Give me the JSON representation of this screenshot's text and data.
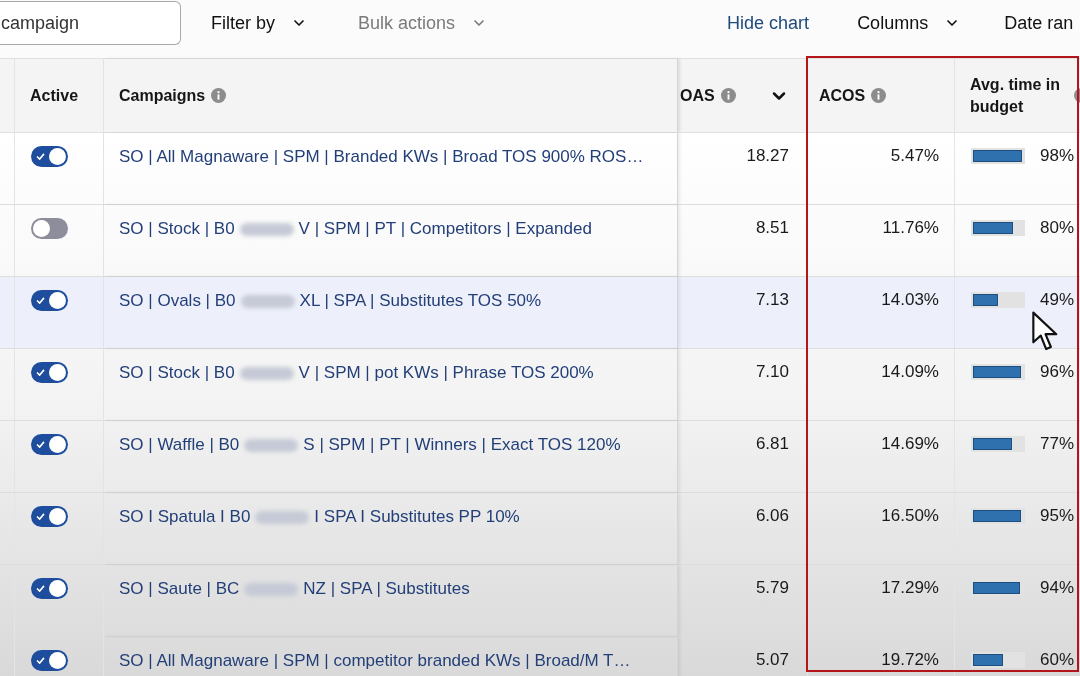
{
  "toolbar": {
    "search": {
      "placeholder": "campaign"
    },
    "items": [
      {
        "label": "Filter by",
        "kind": "dropdown",
        "disabled": false
      },
      {
        "label": "Bulk actions",
        "kind": "dropdown",
        "disabled": true
      },
      {
        "label": "Hide chart",
        "kind": "link",
        "disabled": false
      },
      {
        "label": "Columns",
        "kind": "dropdown",
        "disabled": false
      },
      {
        "label": "Date ran",
        "kind": "button",
        "disabled": false
      }
    ]
  },
  "table": {
    "columns": [
      {
        "label": "Active",
        "kind": "plain"
      },
      {
        "label": "Campaigns",
        "kind": "info"
      },
      {
        "label": "OAS",
        "kind": "info_sort"
      },
      {
        "label": "ACOS",
        "kind": "info"
      },
      {
        "label": "Avg. time in budget",
        "kind": "info"
      }
    ],
    "rows": [
      {
        "active": true,
        "highlighted": false,
        "campaign": [
          "SO | All Magnaware | SPM | Branded KWs | Broad TOS 900% ROS…"
        ],
        "roas": "18.27",
        "acos": "5.47%",
        "budget": {
          "level": 0.98,
          "reading": "98%"
        }
      },
      {
        "active": false,
        "highlighted": false,
        "campaign": [
          "SO | Stock | B0",
          "V | SPM | PT | Competitors | Expanded"
        ],
        "roas": "8.51",
        "acos": "11.76%",
        "budget": {
          "level": 0.8,
          "reading": "80%"
        }
      },
      {
        "active": true,
        "highlighted": true,
        "campaign": [
          "SO | Ovals | B0",
          "XL | SPA | Substitutes TOS 50%"
        ],
        "roas": "7.13",
        "acos": "14.03%",
        "budget": {
          "level": 0.49,
          "reading": "49%"
        }
      },
      {
        "active": true,
        "highlighted": false,
        "campaign": [
          "SO | Stock | B0",
          "V | SPM | pot KWs | Phrase TOS 200%"
        ],
        "roas": "7.10",
        "acos": "14.09%",
        "budget": {
          "level": 0.96,
          "reading": "96%"
        }
      },
      {
        "active": true,
        "highlighted": false,
        "campaign": [
          "SO | Waffle | B0",
          "S | SPM | PT | Winners | Exact TOS 120%"
        ],
        "roas": "6.81",
        "acos": "14.69%",
        "budget": {
          "level": 0.77,
          "reading": "77%"
        }
      },
      {
        "active": true,
        "highlighted": false,
        "campaign": [
          "SO I Spatula I B0",
          "I SPA I Substitutes PP 10%"
        ],
        "roas": "6.06",
        "acos": "16.50%",
        "budget": {
          "level": 0.95,
          "reading": "95%"
        }
      },
      {
        "active": true,
        "highlighted": false,
        "campaign": [
          "SO | Saute | BC",
          "NZ | SPA | Substitutes"
        ],
        "roas": "5.79",
        "acos": "17.29%",
        "budget": {
          "level": 0.94,
          "reading": "94%"
        }
      },
      {
        "active": true,
        "highlighted": false,
        "campaign": [
          "SO | All Magnaware | SPM | competitor branded KWs | Broad/M T…"
        ],
        "roas": "5.07",
        "acos": "19.72%",
        "budget": {
          "level": 0.6,
          "reading": "60%"
        }
      }
    ]
  }
}
